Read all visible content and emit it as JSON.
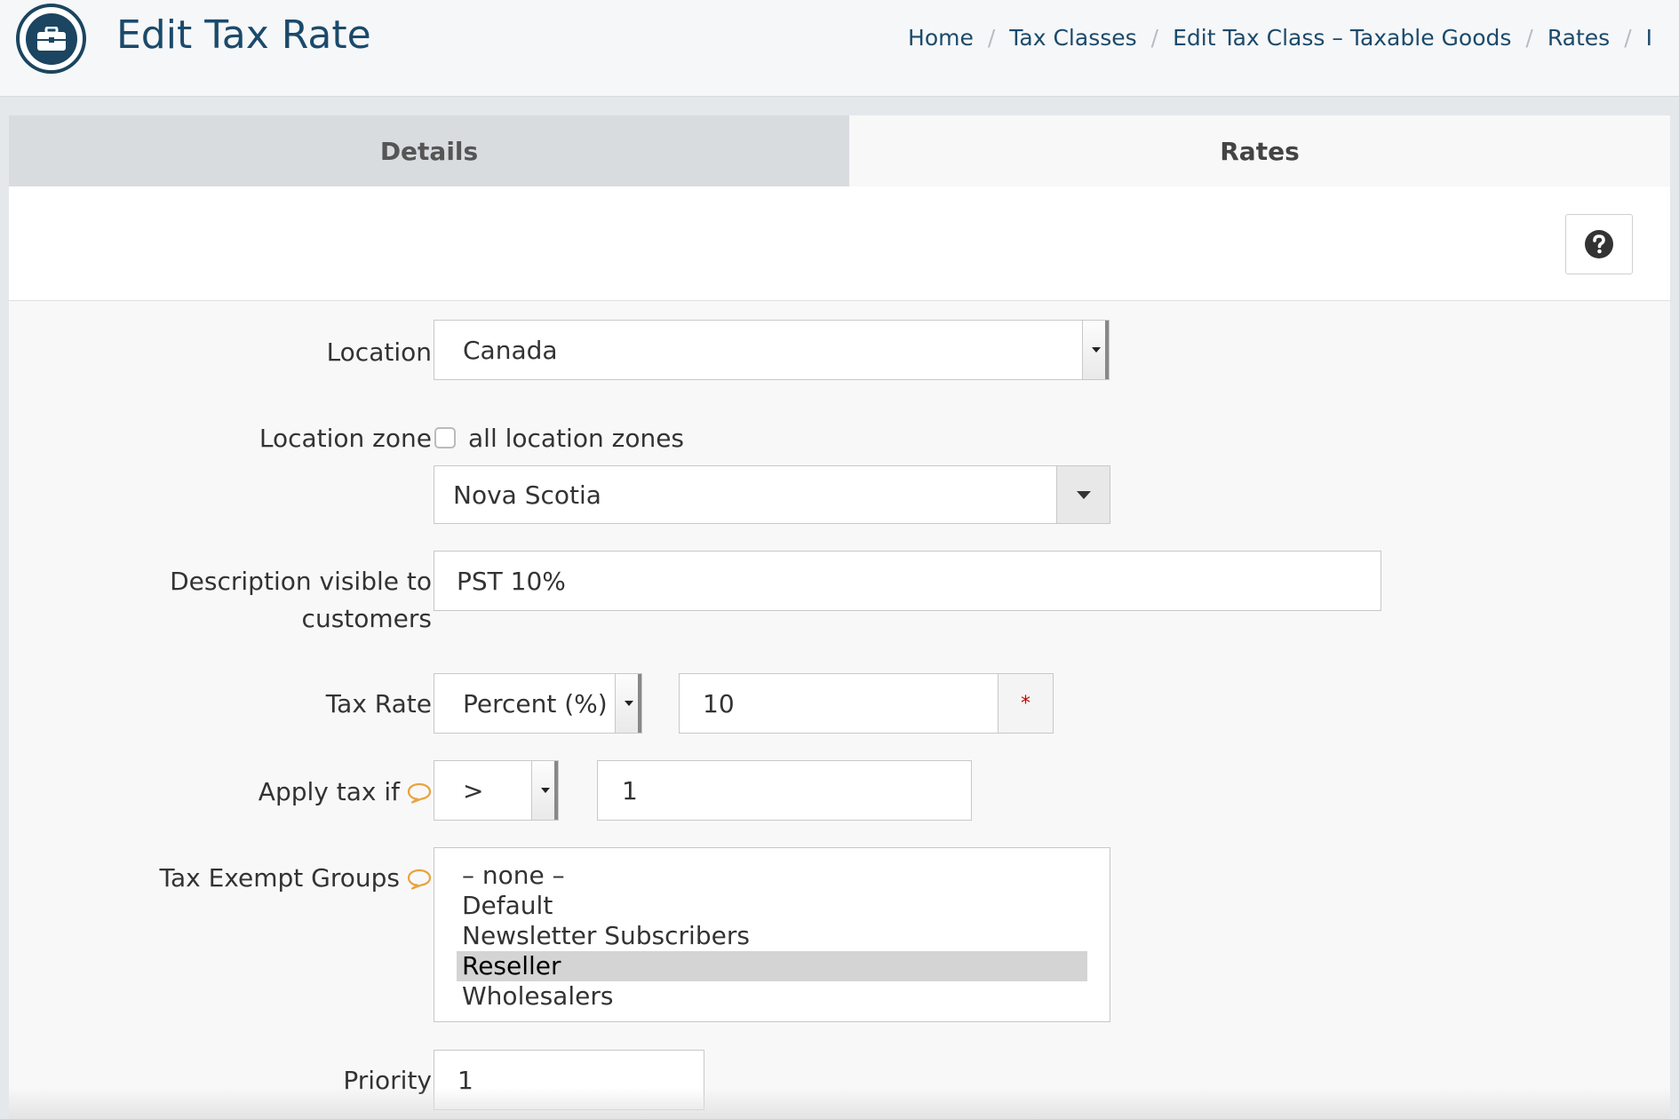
{
  "header": {
    "title": "Edit Tax Rate",
    "icon": "briefcase-icon",
    "breadcrumb": [
      "Home",
      "Tax Classes",
      "Edit Tax Class – Taxable Goods",
      "Rates",
      "I"
    ]
  },
  "tabs": [
    {
      "label": "Details",
      "active": false
    },
    {
      "label": "Rates",
      "active": true
    }
  ],
  "toolbar": {
    "help_icon": "question-circle-icon"
  },
  "form": {
    "location": {
      "label": "Location",
      "value": "Canada"
    },
    "location_zone": {
      "label": "Location zone",
      "all_zones_label": "all location zones",
      "all_zones_checked": false,
      "value": "Nova Scotia"
    },
    "description": {
      "label_line1": "Description visible to",
      "label_line2": "customers",
      "value": "PST 10%"
    },
    "tax_rate": {
      "label": "Tax Rate",
      "type": "Percent (%)",
      "value": "10",
      "required_mark": "*"
    },
    "apply_tax_if": {
      "label": "Apply tax if",
      "operator": ">",
      "value": "1"
    },
    "tax_exempt_groups": {
      "label": "Tax Exempt Groups",
      "options": [
        "– none –",
        "Default",
        "Newsletter Subscribers",
        "Reseller",
        "Wholesalers"
      ],
      "selected": "Reseller"
    },
    "priority": {
      "label": "Priority",
      "value": "1"
    }
  },
  "colors": {
    "title": "#1b4a6b",
    "tip_icon": "#e8a33d",
    "required": "#cc0000"
  }
}
